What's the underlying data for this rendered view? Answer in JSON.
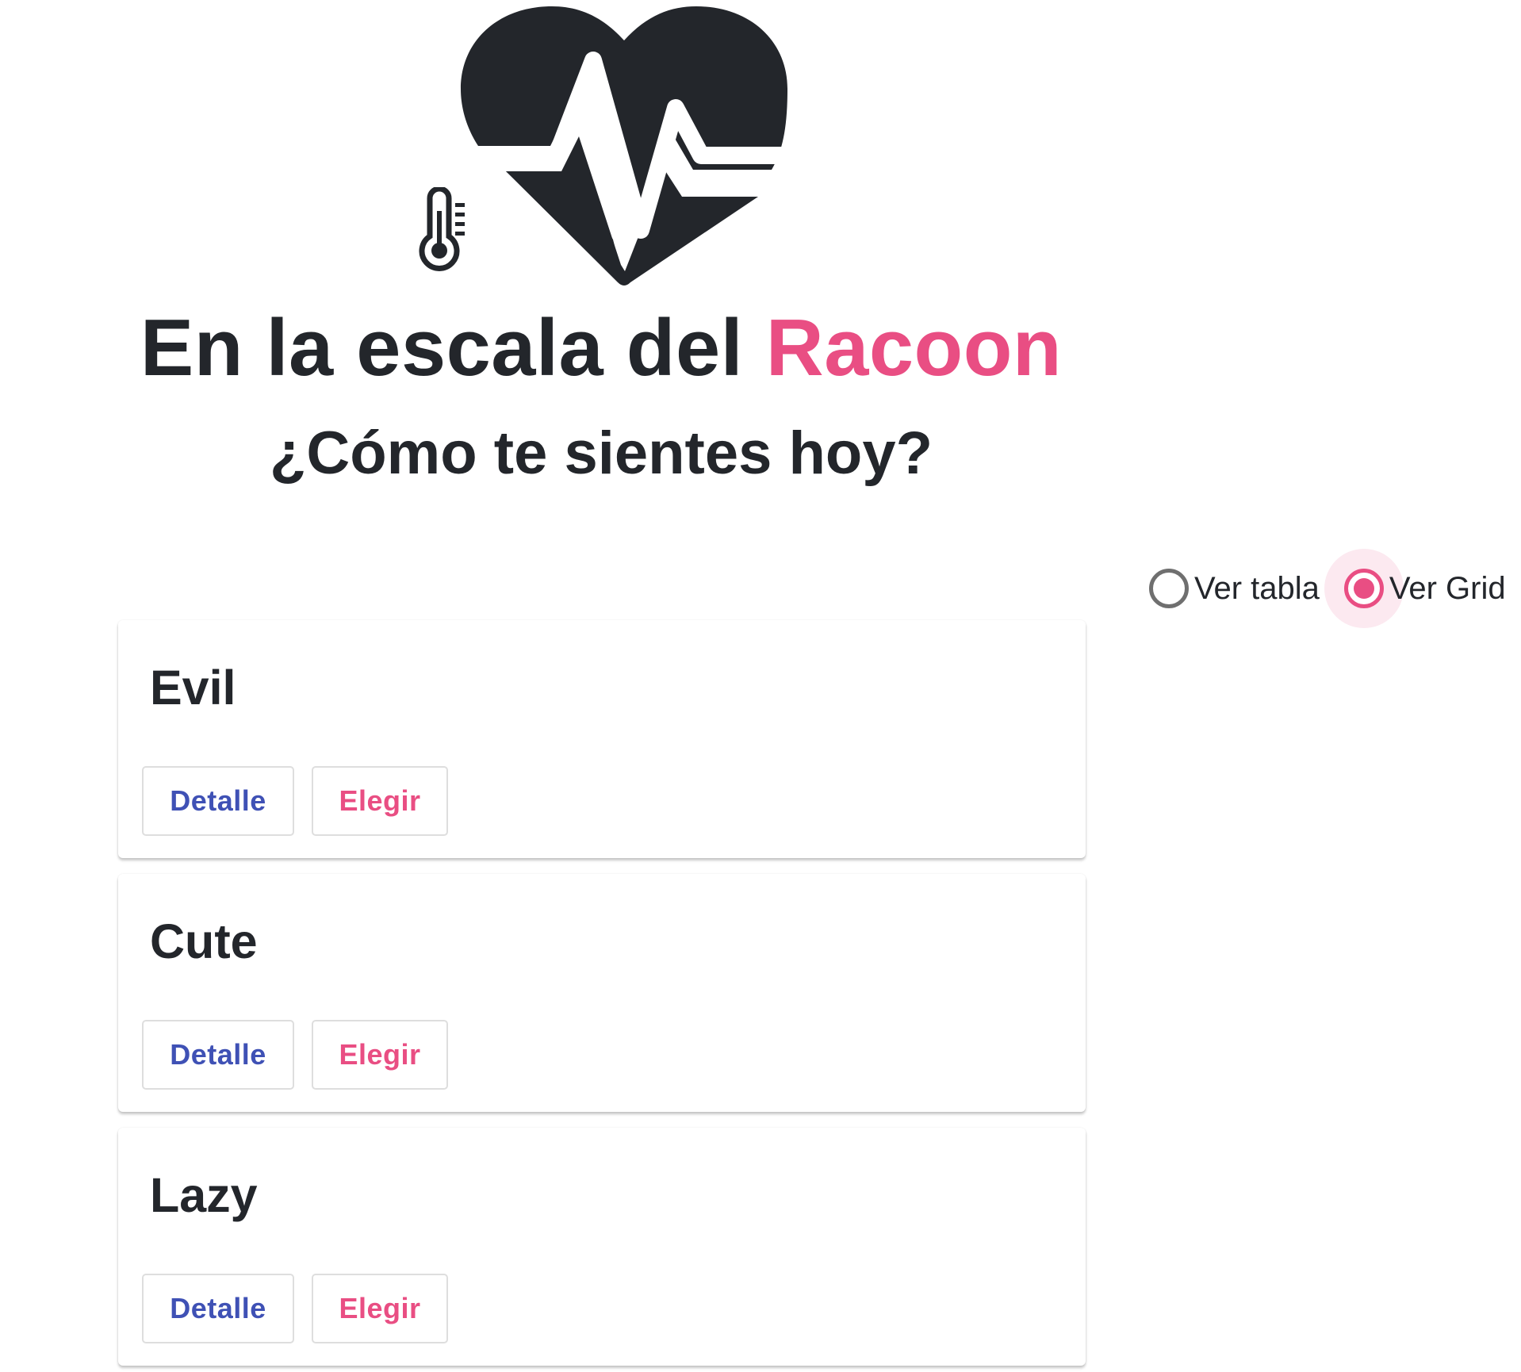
{
  "header": {
    "logo_icon": "heart-pulse-icon",
    "thermometer_icon": "thermometer-icon",
    "title_prefix": "En la escala del ",
    "title_accent": "Racoon",
    "subtitle": "¿Cómo te sientes hoy?"
  },
  "view_toggle": {
    "options": [
      {
        "label": "Ver tabla",
        "selected": false
      },
      {
        "label": "Ver Grid",
        "selected": true
      }
    ]
  },
  "moods": [
    {
      "name": "Evil",
      "detail_label": "Detalle",
      "choose_label": "Elegir"
    },
    {
      "name": "Cute",
      "detail_label": "Detalle",
      "choose_label": "Elegir"
    },
    {
      "name": "Lazy",
      "detail_label": "Detalle",
      "choose_label": "Elegir"
    }
  ],
  "colors": {
    "accent": "#e94e83",
    "primary": "#3f51b5",
    "text": "#23262b"
  }
}
